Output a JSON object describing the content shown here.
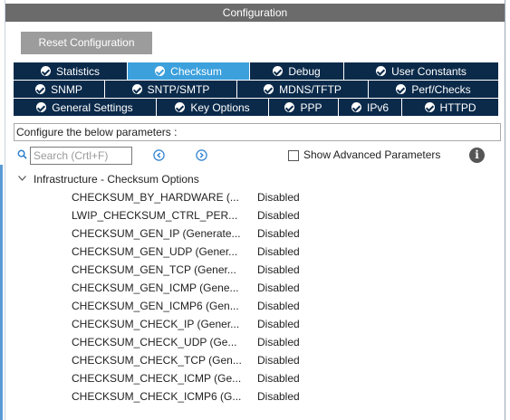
{
  "window": {
    "title": "Configuration"
  },
  "toolbar": {
    "reset_label": "Reset Configuration"
  },
  "tabs": {
    "row1": [
      {
        "label": "Statistics",
        "active": false
      },
      {
        "label": "Checksum",
        "active": true
      },
      {
        "label": "Debug",
        "active": false
      },
      {
        "label": "User Constants",
        "active": false
      }
    ],
    "row2": [
      {
        "label": "SNMP"
      },
      {
        "label": "SNTP/SMTP"
      },
      {
        "label": "MDNS/TFTP"
      },
      {
        "label": "Perf/Checks"
      }
    ],
    "row3": [
      {
        "label": "General Settings"
      },
      {
        "label": "Key Options"
      },
      {
        "label": "PPP"
      },
      {
        "label": "IPv6"
      },
      {
        "label": "HTTPD"
      }
    ]
  },
  "config_label": "Configure the below parameters :",
  "search": {
    "placeholder": "Search (Crtl+F)"
  },
  "advanced": {
    "label": "Show Advanced Parameters",
    "checked": false
  },
  "tree": {
    "group_label": "Infrastructure - Checksum Options",
    "params": [
      {
        "name": "CHECKSUM_BY_HARDWARE (...",
        "value": "Disabled"
      },
      {
        "name": "LWIP_CHECKSUM_CTRL_PER...",
        "value": "Disabled"
      },
      {
        "name": "CHECKSUM_GEN_IP (Generate...",
        "value": "Disabled"
      },
      {
        "name": "CHECKSUM_GEN_UDP (Gener...",
        "value": "Disabled"
      },
      {
        "name": "CHECKSUM_GEN_TCP (Gener...",
        "value": "Disabled"
      },
      {
        "name": "CHECKSUM_GEN_ICMP (Gene...",
        "value": "Disabled"
      },
      {
        "name": "CHECKSUM_GEN_ICMP6 (Gen...",
        "value": "Disabled"
      },
      {
        "name": "CHECKSUM_CHECK_IP (Gener...",
        "value": "Disabled"
      },
      {
        "name": "CHECKSUM_CHECK_UDP (Ge...",
        "value": "Disabled"
      },
      {
        "name": "CHECKSUM_CHECK_TCP (Gen...",
        "value": "Disabled"
      },
      {
        "name": "CHECKSUM_CHECK_ICMP (Ge...",
        "value": "Disabled"
      },
      {
        "name": "CHECKSUM_CHECK_ICMP6 (G...",
        "value": "Disabled"
      }
    ]
  },
  "colors": {
    "tab_bg": "#0b2a4a",
    "tab_active_bg": "#3ca0dc",
    "title_bar": "#6b6b6b",
    "reset_button": "#9c9c9c"
  }
}
